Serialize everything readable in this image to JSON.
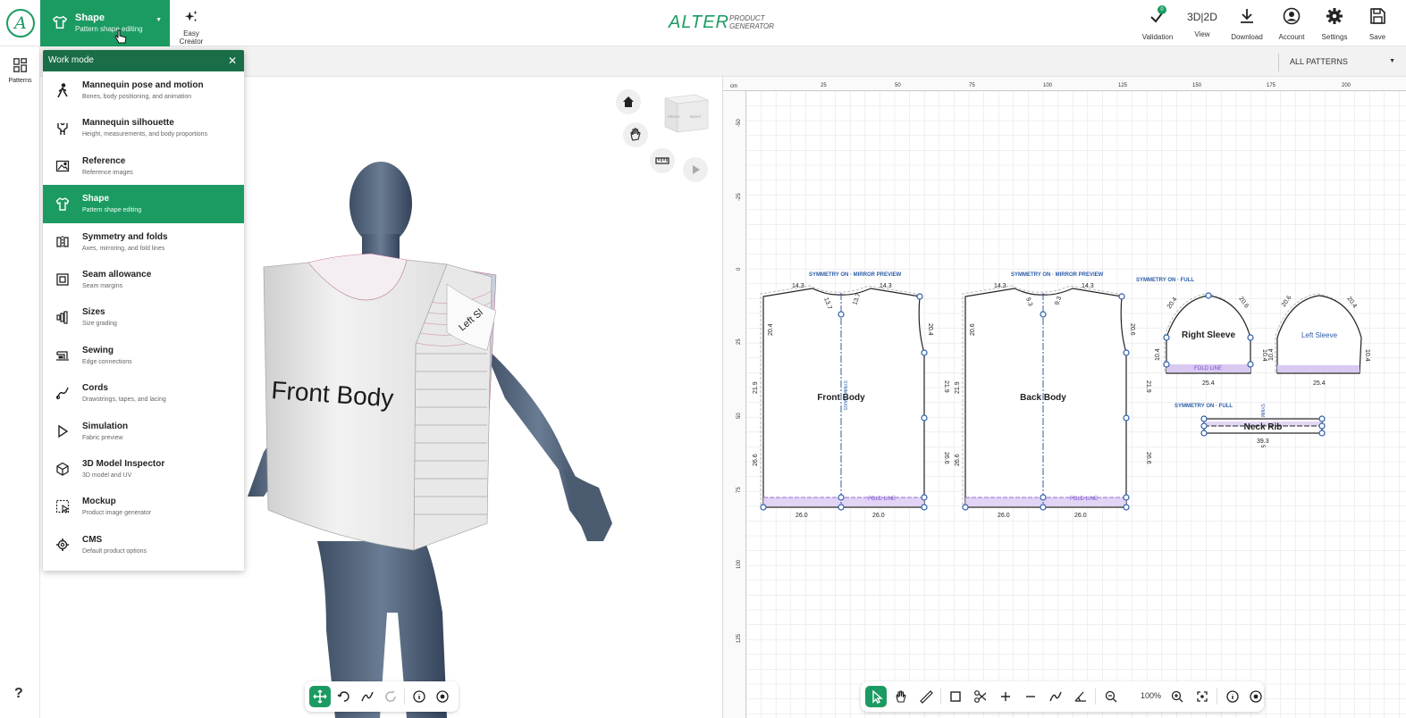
{
  "topbar": {
    "logo_letter": "A",
    "mode_title": "Shape",
    "mode_subtitle": "Pattern shape editing",
    "easy_creator": "Easy Creator",
    "brand_main": "ALTER",
    "brand_sub_1": "PRODUCT",
    "brand_sub_2": "GENERATOR",
    "validation_label": "Validation",
    "validation_badge": "0",
    "view_label": "View",
    "view_toggle": "3D|2D",
    "download_label": "Download",
    "account_label": "Account",
    "settings_label": "Settings",
    "save_label": "Save"
  },
  "rail": {
    "patterns_label": "Patterns",
    "help": "?"
  },
  "subbar": {
    "filter_value": "ALL PATTERNS"
  },
  "work_mode": {
    "title": "Work mode",
    "items": [
      {
        "title": "Mannequin pose and motion",
        "subtitle": "Bones, body positioning, and animation",
        "icon": "walk-icon"
      },
      {
        "title": "Mannequin silhouette",
        "subtitle": "Height, measurements, and body proportions",
        "icon": "silhouette-icon"
      },
      {
        "title": "Reference",
        "subtitle": "Reference images",
        "icon": "image-icon"
      },
      {
        "title": "Shape",
        "subtitle": "Pattern shape editing",
        "icon": "shirt-icon",
        "active": true
      },
      {
        "title": "Symmetry and folds",
        "subtitle": "Axes, mirroring, and fold lines",
        "icon": "symmetry-icon"
      },
      {
        "title": "Seam allowance",
        "subtitle": "Seam margins",
        "icon": "seam-icon"
      },
      {
        "title": "Sizes",
        "subtitle": "Size grading",
        "icon": "sizes-icon"
      },
      {
        "title": "Sewing",
        "subtitle": "Edge connections",
        "icon": "sewing-machine-icon"
      },
      {
        "title": "Cords",
        "subtitle": "Drawstrings, tapes, and lacing",
        "icon": "cord-icon"
      },
      {
        "title": "Simulation",
        "subtitle": "Fabric preview",
        "icon": "play-icon"
      },
      {
        "title": "3D Model Inspector",
        "subtitle": "3D model and UV",
        "icon": "cube-icon"
      },
      {
        "title": "Mockup",
        "subtitle": "Product image generator",
        "icon": "mockup-icon"
      },
      {
        "title": "CMS",
        "subtitle": "Default product options",
        "icon": "gear-icon"
      }
    ]
  },
  "view3d": {
    "front_text": "Front Body",
    "sleeve_text": "Left Sl",
    "cube_front": "FRONT",
    "cube_right": "RIGHT"
  },
  "view2d": {
    "unit": "cm",
    "ruler_x": [
      "25",
      "50",
      "75",
      "100",
      "125",
      "150",
      "175",
      "200"
    ],
    "ruler_y": [
      "-50",
      "-25",
      "0",
      "25",
      "50",
      "75",
      "100",
      "125"
    ],
    "zoom": "100%",
    "pieces": {
      "front": {
        "label": "Front Body",
        "symmetry": "SYMMETRY ON · MIRROR PREVIEW",
        "axis": "SYMM. Y AXIS",
        "fold": "FOLD LINE",
        "dims": {
          "shoulder_l": "14.3",
          "shoulder_r": "14.3",
          "neck_l": "13.7",
          "neck_r": "13.7",
          "arm_l": "20.4",
          "arm_r": "20.4",
          "side_l_top": "21.9",
          "side_r_top": "21.9",
          "side_l_bot": "26.6",
          "side_r_bot": "26.6",
          "hem_l": "26.0",
          "hem_r": "26.0"
        }
      },
      "back": {
        "label": "Back Body",
        "symmetry": "SYMMETRY ON · MIRROR PREVIEW",
        "fold": "FOLD LINE",
        "dims": {
          "shoulder_l": "14.3",
          "shoulder_r": "14.3",
          "neck_l": "9.3",
          "neck_r": "9.3",
          "arm_l": "20.6",
          "arm_r": "20.6",
          "side_l_top": "21.9",
          "side_r_top": "21.9",
          "side_l_bot": "26.6",
          "side_r_bot": "26.6",
          "hem_l": "26.0",
          "hem_r": "26.0"
        }
      },
      "right_sleeve": {
        "label": "Right Sleeve",
        "symmetry": "SYMMETRY ON · FULL",
        "fold": "FOLD LINE",
        "dims": {
          "cap_l": "20.4",
          "cap_r": "20.6",
          "side_l": "10.4",
          "side_r": "10.4",
          "width": "25.4"
        }
      },
      "left_sleeve": {
        "label": "Left Sleeve",
        "dims": {
          "cap_l": "20.6",
          "cap_r": "20.4",
          "side_l": "10.4",
          "side_r": "10.4",
          "width": "25.4"
        }
      },
      "neck_rib": {
        "label": "Neck Rib",
        "symmetry": "SYMMETRY ON · FULL",
        "axis": "SYMM",
        "dims": {
          "length": "39.3",
          "height": "5"
        }
      }
    }
  },
  "colors": {
    "accent": "#1b9b62",
    "accent_dark": "#1a6e47",
    "pattern_blue": "#2b5ca8",
    "fold": "#7a4fc9"
  }
}
